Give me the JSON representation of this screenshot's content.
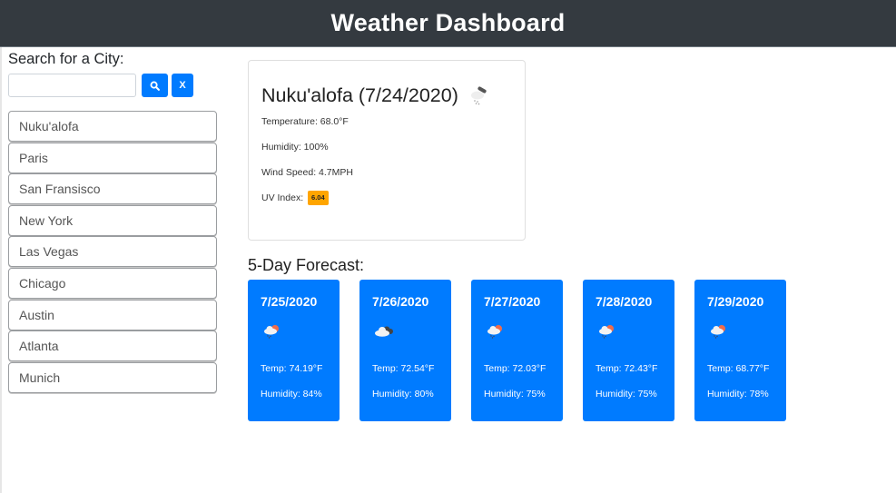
{
  "header": {
    "title": "Weather Dashboard"
  },
  "sidebar": {
    "search_label": "Search for a City:",
    "search_input": {
      "value": "",
      "placeholder": ""
    },
    "search_button_icon": "search-icon",
    "clear_button_label": "X",
    "cities": [
      "Nuku'alofa",
      "Paris",
      "San Fransisco",
      "New York",
      "Las Vegas",
      "Chicago",
      "Austin",
      "Atlanta",
      "Munich"
    ]
  },
  "current": {
    "title": "Nuku'alofa (7/24/2020)",
    "icon": "rain-cloud-icon",
    "temperature": "Temperature: 68.0°F",
    "humidity": "Humidity: 100%",
    "wind": "Wind Speed: 4.7MPH",
    "uv_label": "UV Index:",
    "uv_value": "6.04",
    "uv_color": "#ffa500"
  },
  "forecast": {
    "title": "5-Day Forecast:",
    "days": [
      {
        "date": "7/25/2020",
        "icon": "sun-cloud-rain-icon",
        "temp": "Temp: 74.19°F",
        "humidity": "Humidity: 84%"
      },
      {
        "date": "7/26/2020",
        "icon": "cloudy-icon",
        "temp": "Temp: 72.54°F",
        "humidity": "Humidity: 80%"
      },
      {
        "date": "7/27/2020",
        "icon": "sun-cloud-rain-icon",
        "temp": "Temp: 72.03°F",
        "humidity": "Humidity: 75%"
      },
      {
        "date": "7/28/2020",
        "icon": "sun-cloud-rain-icon",
        "temp": "Temp: 72.43°F",
        "humidity": "Humidity: 75%"
      },
      {
        "date": "7/29/2020",
        "icon": "sun-cloud-rain-icon",
        "temp": "Temp: 68.77°F",
        "humidity": "Humidity: 78%"
      }
    ]
  },
  "colors": {
    "header_bg": "#343a40",
    "primary": "#007bff",
    "uv_moderate": "#ffa500"
  }
}
